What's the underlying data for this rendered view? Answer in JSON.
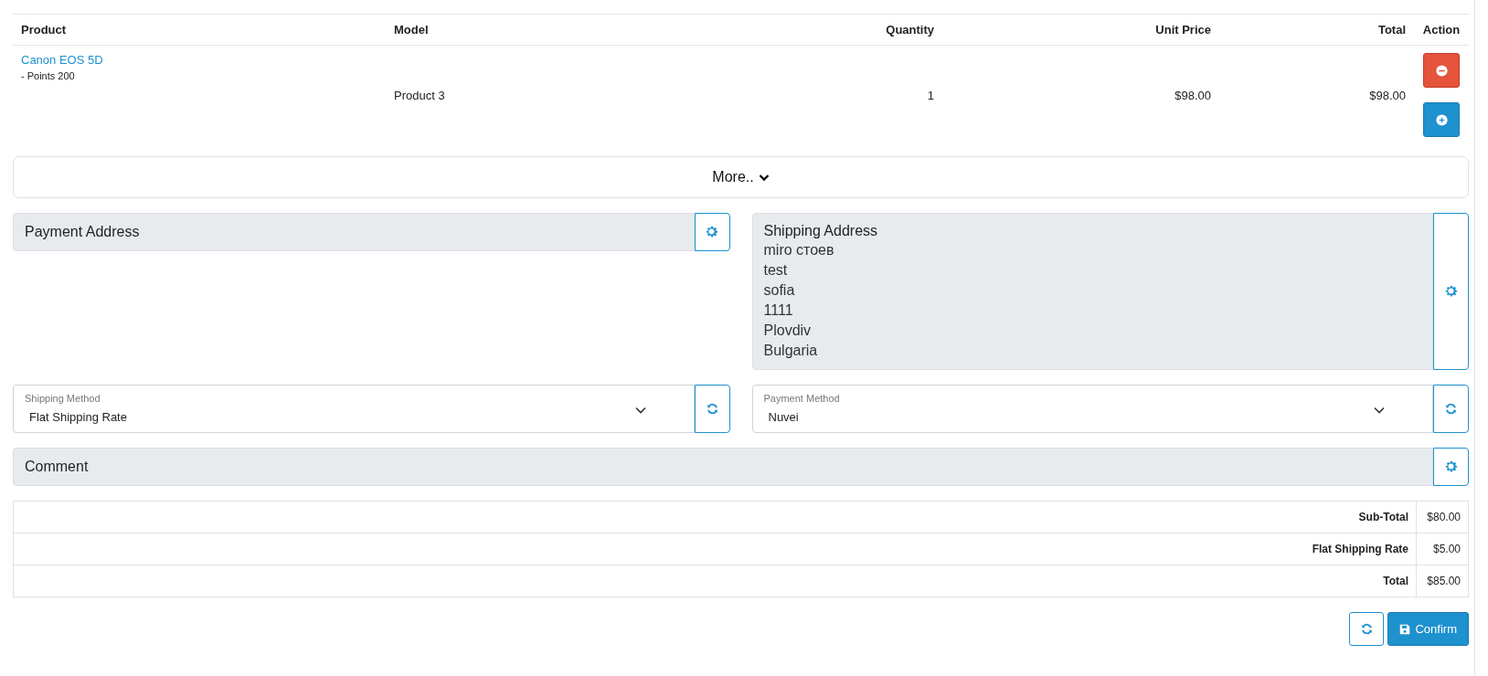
{
  "cart": {
    "columns": [
      "Product",
      "Model",
      "Quantity",
      "Unit Price",
      "Total",
      "Action"
    ],
    "rows": [
      {
        "product": "Canon EOS 5D",
        "option": "- Points 200",
        "model": "Product 3",
        "quantity": "1",
        "unit_price": "$98.00",
        "total": "$98.00"
      }
    ]
  },
  "more_button": "More..",
  "payment_address": {
    "title": "Payment Address"
  },
  "shipping_address": {
    "title": "Shipping Address",
    "lines": [
      "miro стоев",
      "test",
      "sofia",
      "1111",
      "Plovdiv",
      "Bulgaria"
    ]
  },
  "shipping_method": {
    "label": "Shipping Method",
    "value": "Flat Shipping Rate"
  },
  "payment_method": {
    "label": "Payment Method",
    "value": "Nuvei"
  },
  "comment": {
    "title": "Comment"
  },
  "totals": [
    {
      "label": "Sub-Total",
      "value": "$80.00"
    },
    {
      "label": "Flat Shipping Rate",
      "value": "$5.00"
    },
    {
      "label": "Total",
      "value": "$85.00"
    }
  ],
  "confirm_button": "Confirm"
}
